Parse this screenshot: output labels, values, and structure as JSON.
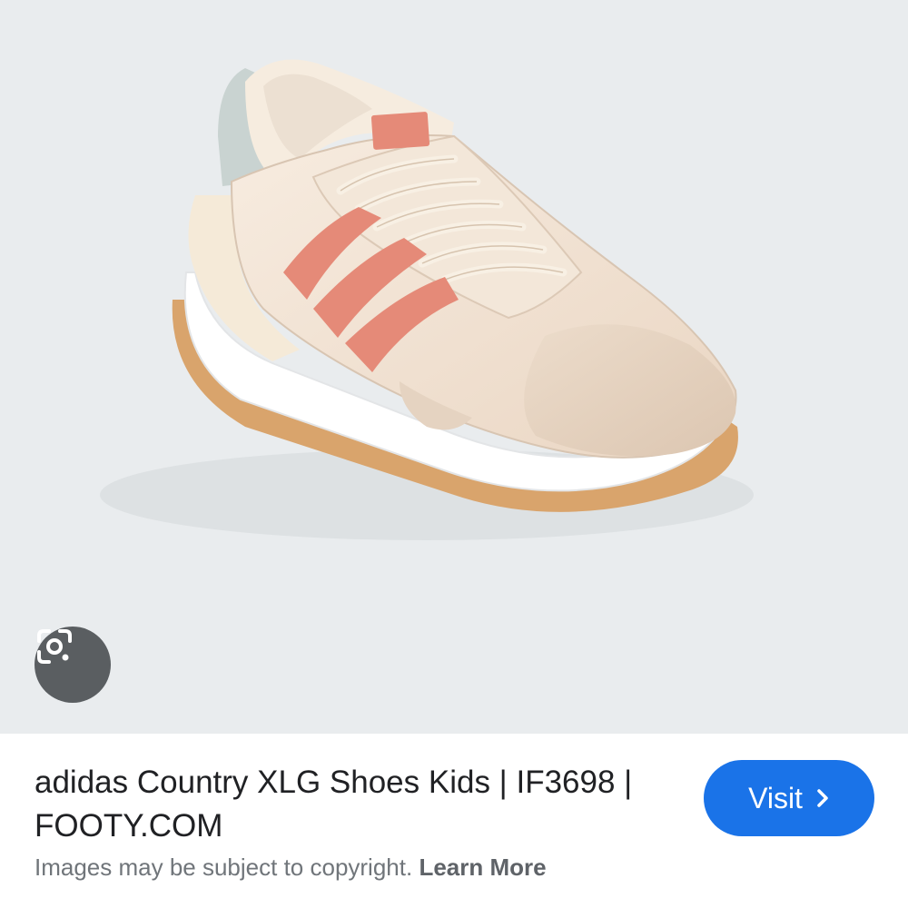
{
  "result": {
    "title_line1": "adidas Country XLG Shoes Kids | IF3698 |",
    "title_line2": "FOOTY.COM",
    "visit_label": "Visit",
    "copyright_text": "Images may be subject to copyright.",
    "learn_more_label": "Learn More"
  },
  "image": {
    "subject": "Beige sneaker with salmon pink three stripes, white platform midsole and gum outsole",
    "icons": [
      "google-lens-icon",
      "chevron-right-icon"
    ]
  },
  "colors": {
    "image_background": "#e9ecee",
    "visit_button": "#1a73e8",
    "lens_button": "#5a5e61",
    "stripes": "#e58a78",
    "upper": "#f1e3d3",
    "sole_gum": "#d9a46c"
  }
}
